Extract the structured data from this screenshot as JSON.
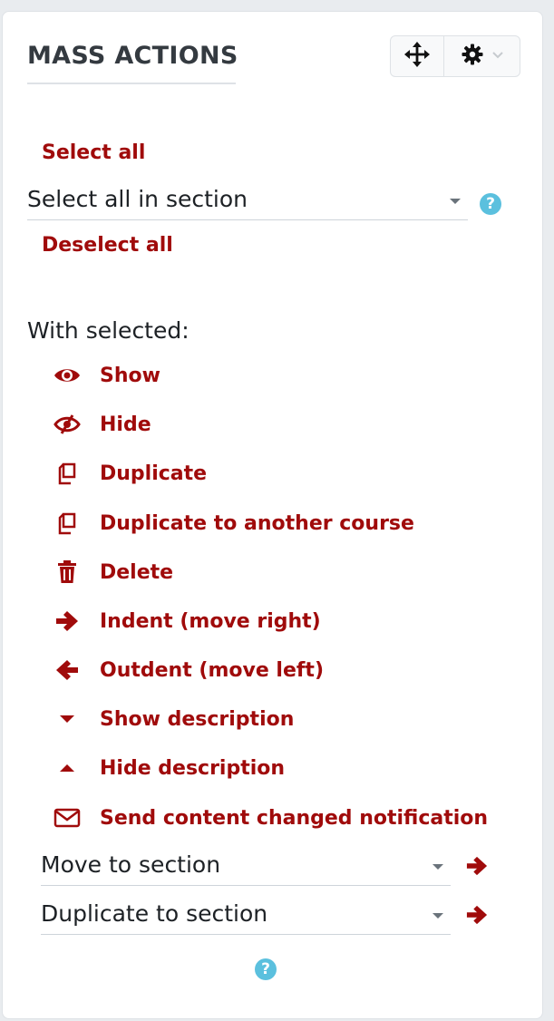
{
  "block": {
    "title": "MASS ACTIONS",
    "controls": {
      "move_icon": "move-arrows-icon",
      "gear_icon": "gear-icon"
    }
  },
  "selection": {
    "select_all": "Select all",
    "select_in_section": {
      "value": "Select all in section"
    },
    "deselect_all": "Deselect all"
  },
  "with_selected_label": "With selected:",
  "actions": [
    {
      "label": "Show",
      "icon": "eye-icon"
    },
    {
      "label": "Hide",
      "icon": "eye-slash-icon"
    },
    {
      "label": "Duplicate",
      "icon": "copy-icon"
    },
    {
      "label": "Duplicate to another course",
      "icon": "copy-icon"
    },
    {
      "label": "Delete",
      "icon": "trash-icon"
    },
    {
      "label": "Indent (move right)",
      "icon": "arrow-right-icon"
    },
    {
      "label": "Outdent (move left)",
      "icon": "arrow-left-icon"
    },
    {
      "label": "Show description",
      "icon": "caret-down-icon"
    },
    {
      "label": "Hide description",
      "icon": "caret-up-icon"
    },
    {
      "label": "Send content changed notification",
      "icon": "envelope-icon"
    }
  ],
  "move_to_section": {
    "value": "Move to section"
  },
  "duplicate_to_section": {
    "value": "Duplicate to section"
  },
  "help_glyph": "?",
  "colors": {
    "accent": "#a00b0b",
    "help": "#5bc0de",
    "title": "#343a40"
  }
}
